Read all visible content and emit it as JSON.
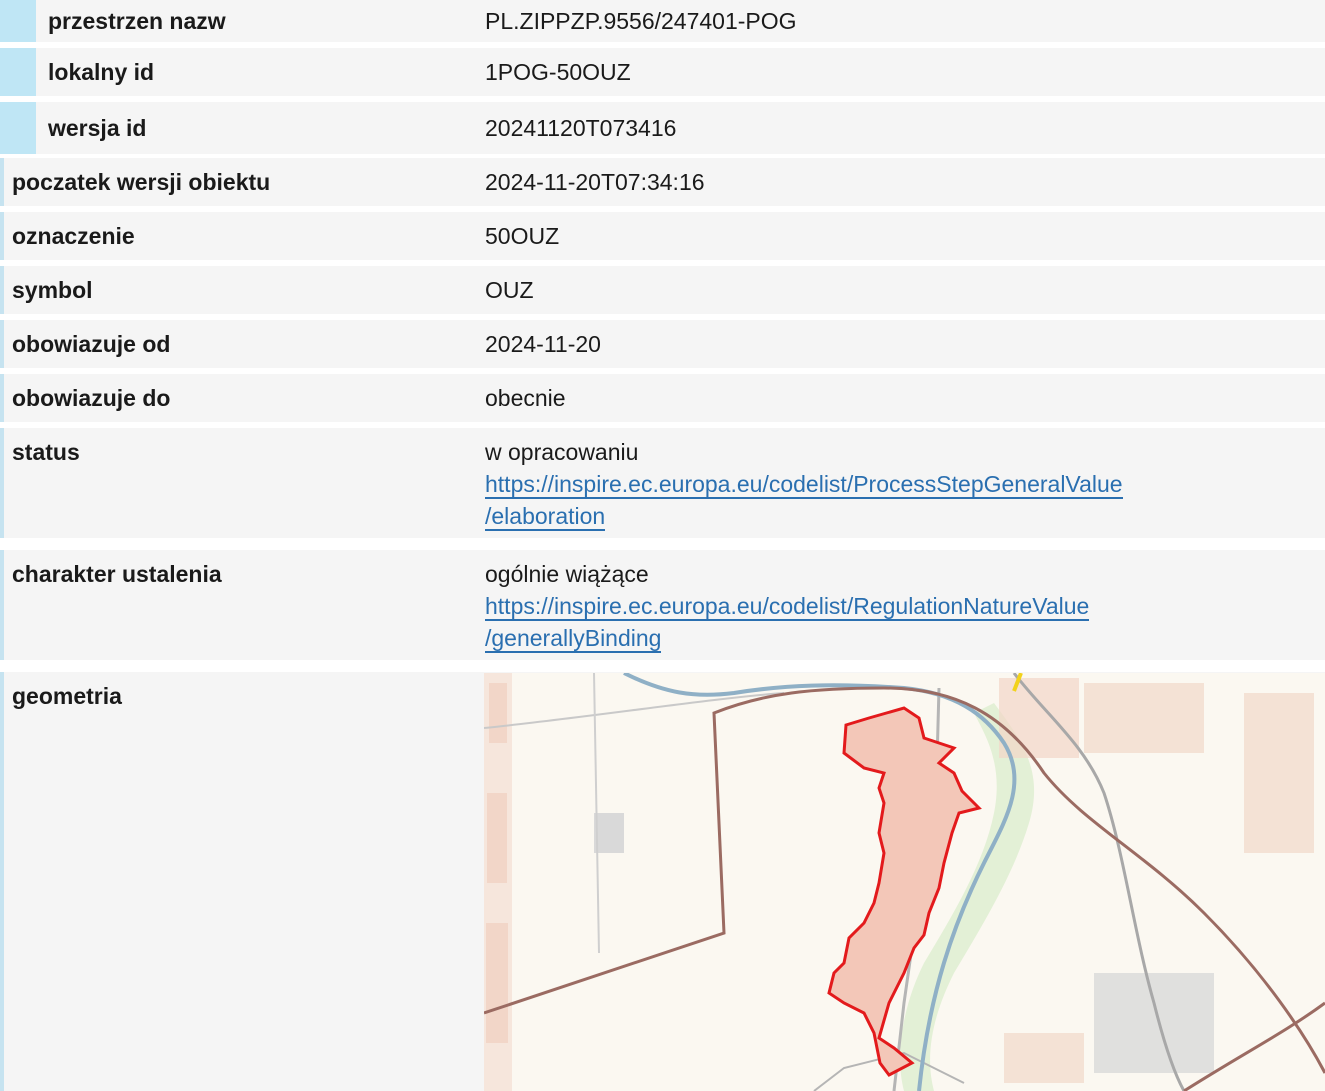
{
  "rows": [
    {
      "key": "przestrzen nazw",
      "value": "PL.ZIPPZP.9556/247401-POG"
    },
    {
      "key": "lokalny id",
      "value": "1POG-50OUZ"
    },
    {
      "key": "wersja id",
      "value": "20241120T073416"
    },
    {
      "key": "poczatek wersji obiektu",
      "value": "2024-11-20T07:34:16"
    },
    {
      "key": "oznaczenie",
      "value": "50OUZ"
    },
    {
      "key": "symbol",
      "value": "OUZ"
    },
    {
      "key": "obowiazuje od",
      "value": "2024-11-20"
    },
    {
      "key": "obowiazuje do",
      "value": "obecnie"
    }
  ],
  "status": {
    "key": "status",
    "value": "w opracowaniu",
    "link_line1": "https://inspire.ec.europa.eu/codelist/ProcessStepGeneralValue",
    "link_line2": "/elaboration"
  },
  "charakter": {
    "key": "charakter ustalenia",
    "value": "ogólnie wiążące",
    "link_line1": "https://inspire.ec.europa.eu/codelist/RegulationNatureValue",
    "link_line2": "/generallyBinding"
  },
  "geometria": {
    "key": "geometria"
  },
  "colors": {
    "accent": "#c6e3f0",
    "link": "#2a6fb0",
    "boundary": "#e31a1c",
    "background": "#f5f5f5"
  }
}
